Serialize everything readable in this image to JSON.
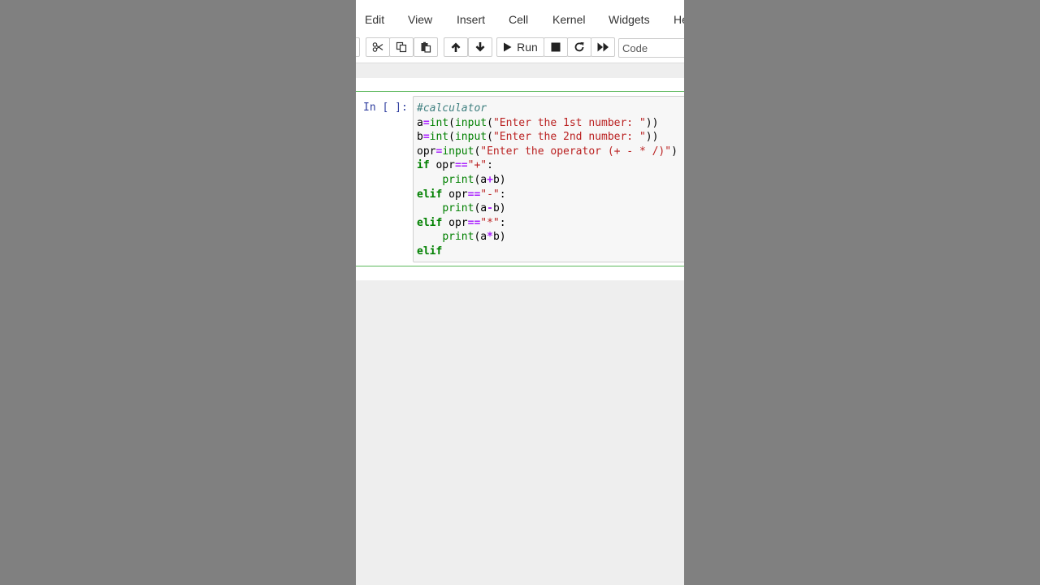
{
  "menu": {
    "items": [
      "Edit",
      "View",
      "Insert",
      "Cell",
      "Kernel",
      "Widgets",
      "He"
    ]
  },
  "toolbar": {
    "run_label": "Run",
    "cell_type": "Code",
    "icons": [
      "scissors-icon",
      "copy-icon",
      "paste-icon",
      "arrow-up-icon",
      "arrow-down-icon",
      "play-icon",
      "stop-icon",
      "restart-icon",
      "fast-forward-icon"
    ]
  },
  "cell": {
    "prompt": "In [ ]:",
    "lines": [
      [
        {
          "t": "#calculator",
          "k": "comment"
        }
      ],
      [
        {
          "t": "a",
          "k": "plain"
        },
        {
          "t": "=",
          "k": "operator"
        },
        {
          "t": "int",
          "k": "builtin"
        },
        {
          "t": "(",
          "k": "plain"
        },
        {
          "t": "input",
          "k": "builtin"
        },
        {
          "t": "(",
          "k": "plain"
        },
        {
          "t": "\"Enter the 1st number: \"",
          "k": "string"
        },
        {
          "t": "))",
          "k": "plain"
        }
      ],
      [
        {
          "t": "b",
          "k": "plain"
        },
        {
          "t": "=",
          "k": "operator"
        },
        {
          "t": "int",
          "k": "builtin"
        },
        {
          "t": "(",
          "k": "plain"
        },
        {
          "t": "input",
          "k": "builtin"
        },
        {
          "t": "(",
          "k": "plain"
        },
        {
          "t": "\"Enter the 2nd number: \"",
          "k": "string"
        },
        {
          "t": "))",
          "k": "plain"
        }
      ],
      [
        {
          "t": "opr",
          "k": "plain"
        },
        {
          "t": "=",
          "k": "operator"
        },
        {
          "t": "input",
          "k": "builtin"
        },
        {
          "t": "(",
          "k": "plain"
        },
        {
          "t": "\"Enter the operator (+ - * /)\"",
          "k": "string"
        },
        {
          "t": ")",
          "k": "plain"
        }
      ],
      [
        {
          "t": "if",
          "k": "keyword"
        },
        {
          "t": " opr",
          "k": "plain"
        },
        {
          "t": "==",
          "k": "operator"
        },
        {
          "t": "\"+\"",
          "k": "string"
        },
        {
          "t": ":",
          "k": "plain"
        }
      ],
      [
        {
          "t": "    ",
          "k": "plain"
        },
        {
          "t": "print",
          "k": "builtin"
        },
        {
          "t": "(a",
          "k": "plain"
        },
        {
          "t": "+",
          "k": "operator"
        },
        {
          "t": "b)",
          "k": "plain"
        }
      ],
      [
        {
          "t": "elif",
          "k": "keyword"
        },
        {
          "t": " opr",
          "k": "plain"
        },
        {
          "t": "==",
          "k": "operator"
        },
        {
          "t": "\"-\"",
          "k": "string"
        },
        {
          "t": ":",
          "k": "plain"
        }
      ],
      [
        {
          "t": "    ",
          "k": "plain"
        },
        {
          "t": "print",
          "k": "builtin"
        },
        {
          "t": "(a",
          "k": "plain"
        },
        {
          "t": "-",
          "k": "operator"
        },
        {
          "t": "b)",
          "k": "plain"
        }
      ],
      [
        {
          "t": "elif",
          "k": "keyword"
        },
        {
          "t": " opr",
          "k": "plain"
        },
        {
          "t": "==",
          "k": "operator"
        },
        {
          "t": "\"*\"",
          "k": "string"
        },
        {
          "t": ":",
          "k": "plain"
        }
      ],
      [
        {
          "t": "    ",
          "k": "plain"
        },
        {
          "t": "print",
          "k": "builtin"
        },
        {
          "t": "(a",
          "k": "plain"
        },
        {
          "t": "*",
          "k": "operator"
        },
        {
          "t": "b)",
          "k": "plain"
        }
      ],
      [
        {
          "t": "elif",
          "k": "keyword"
        }
      ]
    ]
  },
  "colors": {
    "cell_border_active": "#5cb85c",
    "prompt": "#303f9f",
    "keyword": "#008000",
    "string": "#ba2121",
    "comment": "#408080",
    "operator": "#aa22ff"
  }
}
